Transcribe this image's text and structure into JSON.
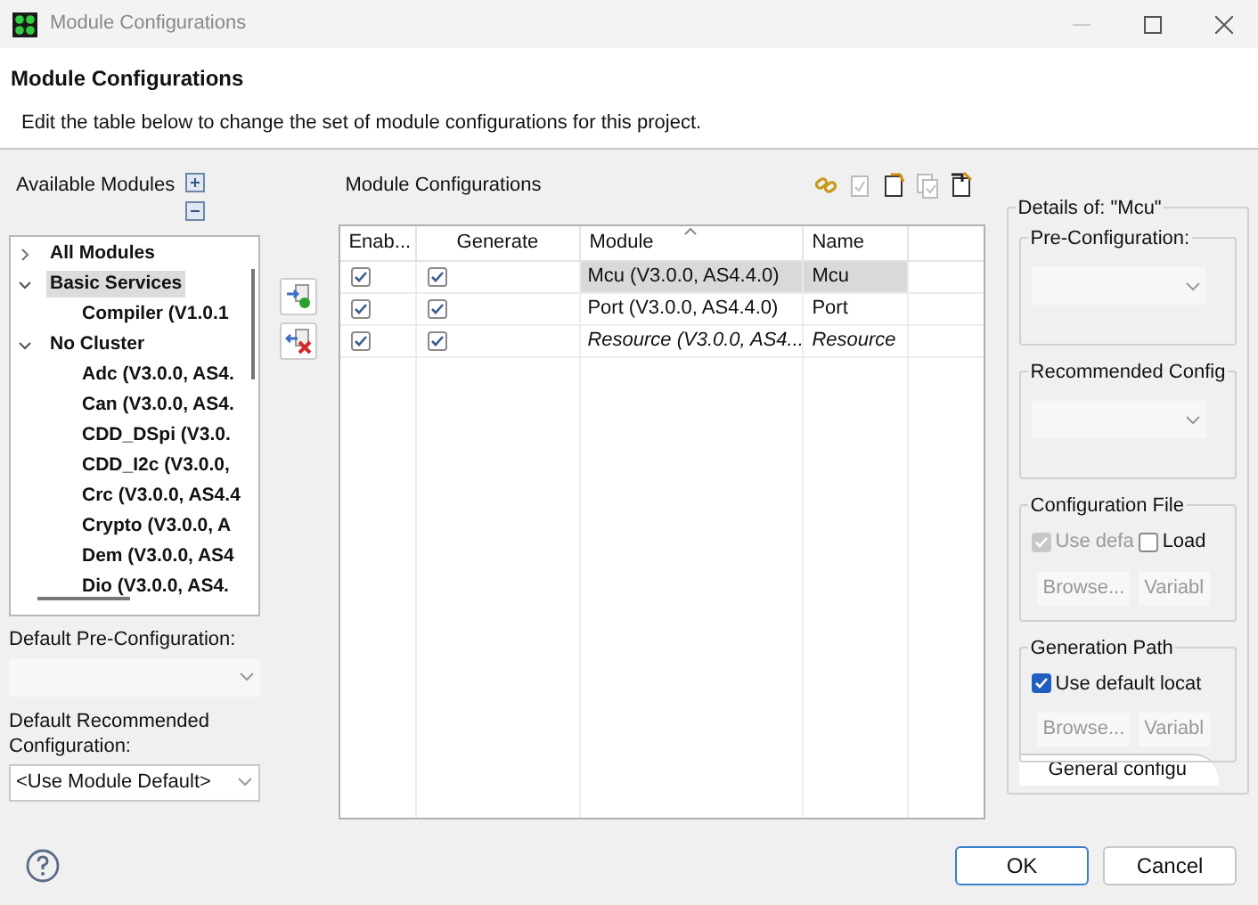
{
  "window": {
    "title": "Module Configurations"
  },
  "header": {
    "title": "Module Configurations",
    "description": "Edit the table below to change the set of module configurations for this project."
  },
  "available": {
    "label": "Available Modules",
    "tree": [
      {
        "label": "All Modules",
        "expanded": false,
        "selected": false
      },
      {
        "label": "Basic Services",
        "expanded": true,
        "selected": true,
        "children": [
          {
            "label": "Compiler (V1.0.1",
            "selected": false
          }
        ]
      },
      {
        "label": "No Cluster",
        "expanded": true,
        "selected": false,
        "children": [
          {
            "label": "Adc (V3.0.0, AS4.",
            "selected": false
          },
          {
            "label": "Can (V3.0.0, AS4.",
            "selected": false
          },
          {
            "label": "CDD_DSpi (V3.0.",
            "selected": false
          },
          {
            "label": "CDD_I2c (V3.0.0,",
            "selected": false
          },
          {
            "label": "Crc (V3.0.0, AS4.4",
            "selected": false
          },
          {
            "label": "Crypto (V3.0.0, A",
            "selected": false
          },
          {
            "label": "Dem (V3.0.0, AS4",
            "selected": false
          },
          {
            "label": "Dio (V3.0.0, AS4.",
            "selected": false
          }
        ]
      }
    ],
    "pre_config": {
      "label": "Default Pre-Configuration:",
      "disabled": true
    },
    "recommended": {
      "label": "Default Recommended Configuration:",
      "value": "<Use Module Default>",
      "disabled": false
    }
  },
  "configurations": {
    "label": "Module Configurations",
    "toolbar": [
      {
        "disabled": false
      },
      {
        "disabled": true
      },
      {
        "disabled": false
      },
      {
        "disabled": true
      },
      {
        "disabled": false
      }
    ],
    "columns": [
      "Enab...",
      "Generate",
      "Module",
      "Name"
    ],
    "rows": [
      {
        "enabled": true,
        "generate": true,
        "module": "Mcu (V3.0.0, AS4.4.0)",
        "name": "Mcu",
        "selected": true,
        "italic": false
      },
      {
        "enabled": true,
        "generate": true,
        "module": "Port (V3.0.0, AS4.4.0)",
        "name": "Port",
        "selected": false,
        "italic": false
      },
      {
        "enabled": true,
        "generate": true,
        "module": "Resource (V3.0.0, AS4...",
        "name": "Resource",
        "selected": false,
        "italic": true
      }
    ]
  },
  "details": {
    "title": "Details of: \"Mcu\"",
    "pre_config": {
      "label": "Pre-Configuration:",
      "disabled": true
    },
    "recommended": {
      "label": "Recommended Config",
      "disabled": true
    },
    "config_file": {
      "label": "Configuration File",
      "checks": [
        {
          "label": "Use defa",
          "checked": true,
          "disabled": true
        },
        {
          "label": "Load",
          "checked": false,
          "disabled": false
        }
      ],
      "buttons": [
        {
          "label": "Browse...",
          "disabled": true
        },
        {
          "label": "Variabl",
          "disabled": true
        }
      ]
    },
    "generation_path": {
      "label": "Generation Path",
      "checks": [
        {
          "label": "Use default locat",
          "checked": true,
          "disabled": false
        }
      ],
      "buttons": [
        {
          "label": "Browse...",
          "disabled": true
        },
        {
          "label": "Variabl",
          "disabled": true
        }
      ]
    },
    "tab": "General configu"
  },
  "buttons": [
    {
      "label": "OK",
      "default": true
    },
    {
      "label": "Cancel",
      "default": false
    }
  ]
}
